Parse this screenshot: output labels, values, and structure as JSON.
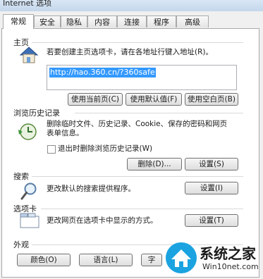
{
  "window": {
    "title": "Internet 选项"
  },
  "tabs": [
    "常规",
    "安全",
    "隐私",
    "内容",
    "连接",
    "程序",
    "高级"
  ],
  "homepage": {
    "heading": "主页",
    "instruction": "若要创建主页选项卡，请在各地址行键入地址(R)。",
    "url": "http://hao.360.cn/?360safe",
    "buttons": {
      "current": "使用当前页(C)",
      "default": "使用默认值(F)",
      "blank": "使用空白页(B)"
    }
  },
  "history": {
    "heading": "浏览历史记录",
    "description_line1": "删除临时文件、历史记录、Cookie、保存的密码和网页",
    "description_line2": "表单信息。",
    "checkbox_label": "退出时删除浏览历史记录(W)",
    "buttons": {
      "delete": "删除(D)...",
      "settings": "设置(S)"
    }
  },
  "search": {
    "heading": "搜索",
    "description": "更改默认的搜索提供程序。",
    "settings_button": "设置(I)"
  },
  "tabs_section": {
    "heading": "选项卡",
    "description": "更改网页在选项卡中显示的方式。",
    "settings_button": "设置(T)"
  },
  "appearance": {
    "heading": "外观",
    "buttons": {
      "colors": "颜色(O)",
      "languages": "语言(L)",
      "fonts": "字"
    }
  },
  "watermark": {
    "brand": "系统之家",
    "site": "Win10net.com"
  }
}
